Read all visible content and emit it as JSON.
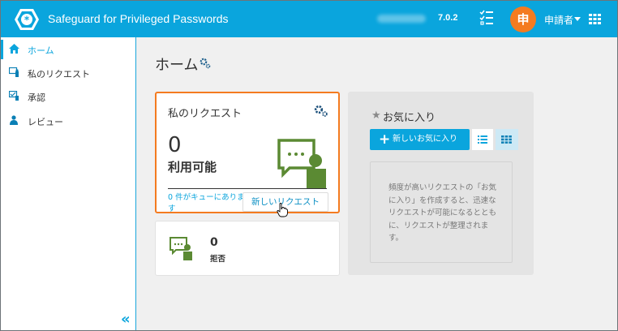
{
  "header": {
    "app_title": "Safeguard for Privileged Passwords",
    "version": "7.0.2",
    "avatar_initial": "申",
    "user_name": "申請者",
    "brand_color": "#0aa5dd"
  },
  "sidebar": {
    "items": [
      {
        "label": "ホーム",
        "icon": "home-icon",
        "active": true
      },
      {
        "label": "私のリクエスト",
        "icon": "my-requests-icon",
        "active": false
      },
      {
        "label": "承認",
        "icon": "approvals-icon",
        "active": false
      },
      {
        "label": "レビュー",
        "icon": "review-icon",
        "active": false
      }
    ],
    "collapse_label": "«"
  },
  "main": {
    "title": "ホーム",
    "my_requests_card": {
      "title": "私のリクエスト",
      "count": "0",
      "status": "利用可能",
      "queue_text": "0 件がキューにあります",
      "new_request_button": "新しいリクエスト"
    },
    "denied_card": {
      "count": "0",
      "label": "拒否"
    },
    "favorites_card": {
      "title": "お気に入り",
      "new_favorite_button": "新しいお気に入り",
      "empty_text": "頻度が高いリクエストの「お気に入り」を作成すると、迅速なリクエストが可能になるとともに、リクエストが整理されます。"
    }
  },
  "colors": {
    "accent": "#0aa5dd",
    "highlight_border": "#f47b20",
    "illustration_green": "#5b8a33",
    "avatar_bg": "#f47b20"
  }
}
